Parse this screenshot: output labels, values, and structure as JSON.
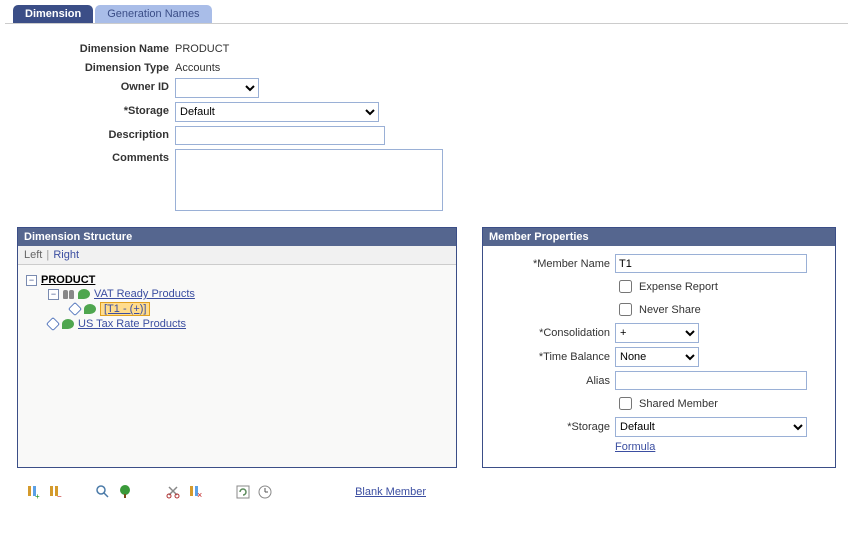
{
  "tabs": {
    "active": "Dimension",
    "inactive": "Generation Names"
  },
  "form": {
    "name_label": "Dimension Name",
    "name_value": "PRODUCT",
    "type_label": "Dimension Type",
    "type_value": "Accounts",
    "owner_label": "Owner ID",
    "owner_value": "",
    "storage_label": "*Storage",
    "storage_value": "Default",
    "description_label": "Description",
    "description_value": "",
    "comments_label": "Comments",
    "comments_value": ""
  },
  "structure": {
    "title": "Dimension Structure",
    "left": "Left",
    "right": "Right",
    "root": "PRODUCT",
    "child1": "VAT Ready Products",
    "selected": "[T1 - (+)]",
    "child2": "US Tax Rate Products"
  },
  "props": {
    "title": "Member Properties",
    "mname_lbl": "*Member Name",
    "mname_val": "T1",
    "expense_lbl": "Expense Report",
    "never_lbl": "Never Share",
    "consol_lbl": "*Consolidation",
    "consol_val": "+",
    "tb_lbl": "*Time Balance",
    "tb_val": "None",
    "alias_lbl": "Alias",
    "alias_val": "",
    "shared_lbl": "Shared Member",
    "storage_lbl": "*Storage",
    "storage_val": "Default",
    "formula": "Formula"
  },
  "bottom": {
    "blank": "Blank Member"
  }
}
